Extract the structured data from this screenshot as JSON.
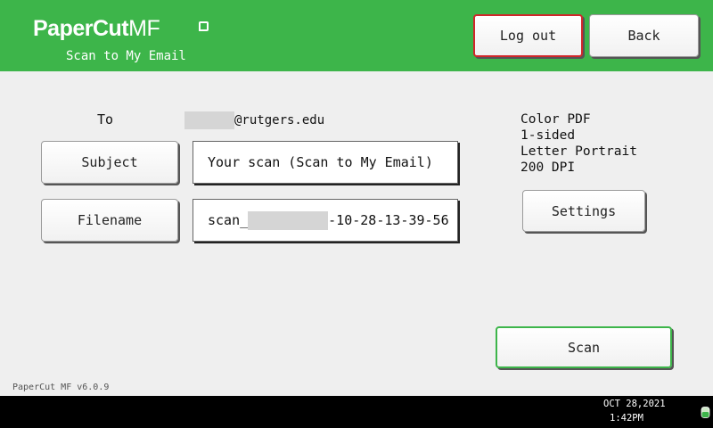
{
  "header": {
    "logo_main": "PaperCut",
    "logo_mf": "MF",
    "subtitle": "Scan to My Email",
    "logout_label": "Log out",
    "back_label": "Back"
  },
  "form": {
    "to_label": "To",
    "email_suffix": "@rutgers.edu",
    "subject_button": "Subject",
    "subject_value": "Your scan (Scan to My Email)",
    "filename_button": "Filename",
    "filename_prefix": "scan_",
    "filename_suffix": "-10-28-13-39-56"
  },
  "scan_settings": {
    "color": "Color PDF",
    "sides": "1-sided",
    "paper": "Letter Portrait",
    "resolution": "200 DPI",
    "settings_button": "Settings"
  },
  "actions": {
    "scan_button": "Scan"
  },
  "footer": {
    "version": "PaperCut MF v6.0.9"
  },
  "statusbar": {
    "date": "OCT  28,2021",
    "time": "1:42PM"
  },
  "colors": {
    "brand_green": "#3db54a",
    "logout_border": "#d0262a",
    "background": "#efefef"
  },
  "icons": {
    "logo": "papercut-logo-icon",
    "status": "toner-status-icon"
  }
}
